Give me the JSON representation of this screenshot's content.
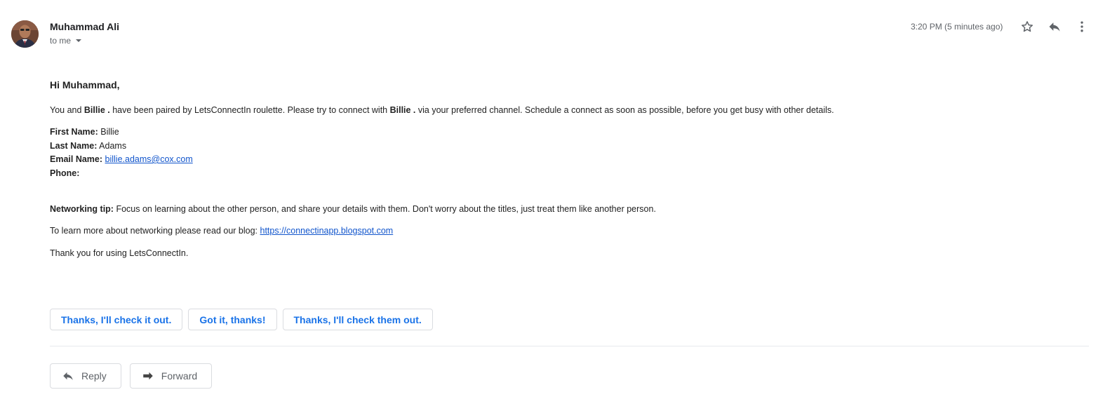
{
  "header": {
    "sender_name": "Muhammad Ali",
    "to_label": "to me",
    "timestamp": "3:20 PM (5 minutes ago)",
    "icons": [
      "avatar",
      "star-icon",
      "reply-icon",
      "more-vert-icon"
    ]
  },
  "body": {
    "greeting": "Hi Muhammad,",
    "intro": {
      "part1": "You and ",
      "name1": "Billie .",
      "part2": " have been paired by LetsConnectIn roulette. Please try to connect with ",
      "name2": "Billie .",
      "part3": " via your preferred channel. Schedule a connect as soon as possible, before you get busy with other details."
    },
    "details": {
      "first_name_label": "First Name:",
      "first_name_value": " Billie",
      "last_name_label": "Last Name:",
      "last_name_value": " Adams",
      "email_label": "Email Name:",
      "email_value": "billie.adams@cox.com",
      "phone_label": "Phone:"
    },
    "tip": {
      "label": "Networking tip:",
      "text": " Focus on learning about the other person, and share your details with them. Don't worry about the titles, just treat them like another person."
    },
    "blog": {
      "text": "To learn more about networking please read our blog: ",
      "link": "https://connectinapp.blogspot.com"
    },
    "closing": "Thank you for using LetsConnectIn."
  },
  "smart_replies": [
    "Thanks, I'll check it out.",
    "Got it, thanks!",
    "Thanks, I'll check them out."
  ],
  "actions": {
    "reply_label": "Reply",
    "forward_label": "Forward"
  },
  "colors": {
    "link": "#1155cc",
    "chip_text": "#1a73e8",
    "icon": "#5f6368"
  }
}
